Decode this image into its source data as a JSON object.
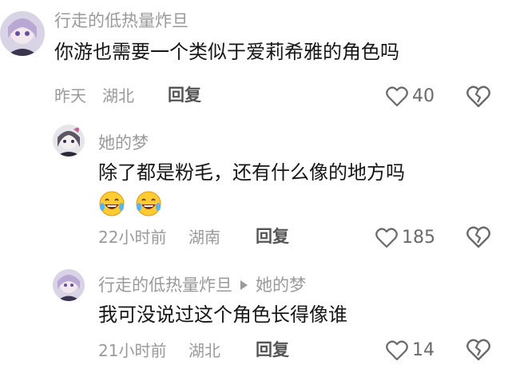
{
  "comments": [
    {
      "username": "行走的低热量炸旦",
      "text": "你游也需要一个类似于爱莉希雅的角色吗",
      "time": "昨天",
      "location": "湖北",
      "reply_label": "回复",
      "likes": "40"
    },
    {
      "username": "她的梦",
      "text": "除了都是粉毛，还有什么像的地方吗",
      "emojis": [
        "laughing-tears",
        "laughing-tears"
      ],
      "time": "22小时前",
      "location": "湖南",
      "reply_label": "回复",
      "likes": "185"
    },
    {
      "username": "行走的低热量炸旦",
      "reply_to": "她的梦",
      "text": "我可没说过这个角色长得像谁",
      "time": "21小时前",
      "location": "湖北",
      "reply_label": "回复",
      "likes": "14"
    }
  ],
  "colors": {
    "username": "#9a9a9a",
    "text": "#161616",
    "meta": "#9a9a9a",
    "reply": "#555555",
    "icon": "#6a6a6a"
  }
}
